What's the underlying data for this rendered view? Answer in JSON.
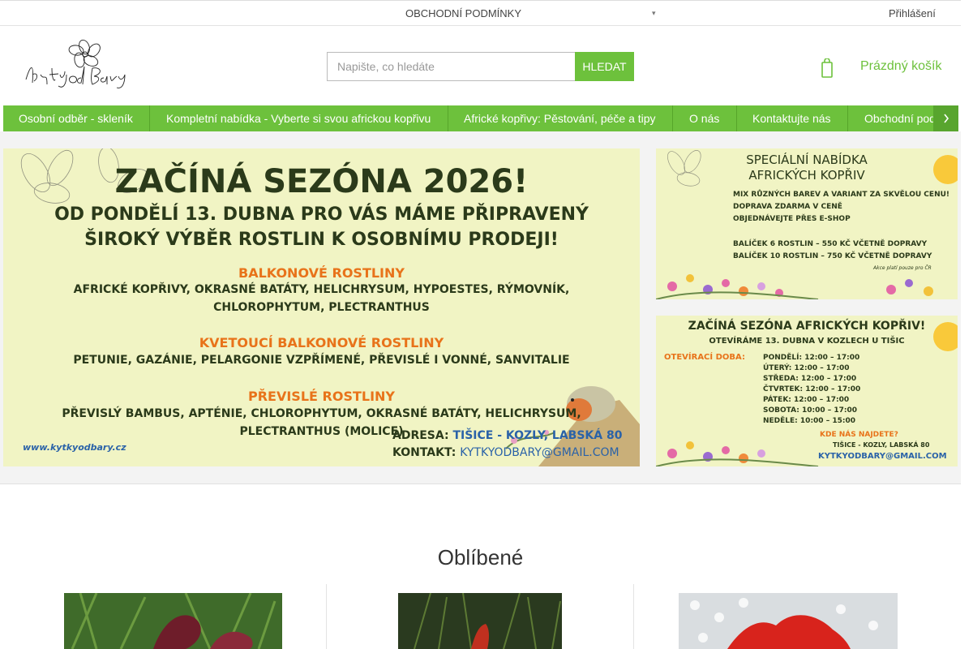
{
  "topbar": {
    "terms_label": "OBCHODNÍ PODMÍNKY",
    "icon": "chevron-icon",
    "login_label": "Přihlášení"
  },
  "header": {
    "logo_alt": "Kytky od Báry",
    "search_placeholder": "Napište, co hledáte",
    "search_button": "HLEDAT",
    "cart_label": "Prázdný košík"
  },
  "nav": {
    "items": [
      "Osobní odběr - skleník",
      "Kompletní nabídka - Vyberte si svou africkou kopřivu",
      "Africké kopřivy: Pěstování, péče a tipy",
      "O nás",
      "Kontaktujte nás",
      "Obchodní pod"
    ]
  },
  "banners": {
    "main": {
      "title": "ZAČÍNÁ SEZÓNA 2026!",
      "subtitle1": "OD PONDĚLÍ 13. DUBNA PRO VÁS MÁME PŘIPRAVENÝ",
      "subtitle2": "ŠIROKÝ VÝBĚR ROSTLIN K OSOBNÍMU PRODEJI!",
      "h1": "BALKONOVÉ ROSTLINY",
      "l1a": "AFRICKÉ KOPŘIVY, OKRASNÉ BATÁTY, HELICHRYSUM, HYPOESTES, RÝMOVNÍK,",
      "l1b": "CHLOROPHYTUM, PLECTRANTHUS",
      "h2": "KVETOUCÍ BALKONOVÉ ROSTLINY",
      "l2": "PETUNIE, GAZÁNIE, PELARGONIE VZPŘÍMENÉ, PŘEVISLÉ I VONNÉ, SANVITALIE",
      "h3": "PŘEVISLÉ ROSTLINY",
      "l3a": "PŘEVISLÝ BAMBUS, APTÉNIE, CHLOROPHYTUM, OKRASNÉ BATÁTY, HELICHRYSUM,",
      "l3b": "PLECTRANTHUS (MOLICE)",
      "address_label": "ADRESA:",
      "address": "TIŠICE - KOZLY, LABSKÁ 80",
      "contact_label": "KONTAKT:",
      "contact": "KYTKYODBARY@GMAIL.COM",
      "web": "www.kytkyodbary.cz"
    },
    "side1": {
      "title1": "SPECIÁLNÍ NABÍDKA",
      "title2": "AFRICKÝCH KOPŘIV",
      "p1": "MIX RŮZNÝCH BAREV A VARIANT ZA SKVĚLOU CENU!",
      "p2": "DOPRAVA ZDARMA V CENĚ",
      "p3": "OBJEDNÁVEJTE PŘES E-SHOP",
      "p4": "BALÍČEK 6 ROSTLIN – 550 KČ VČETNĚ DOPRAVY",
      "p5": "BALÍČEK 10 ROSTLIN – 750 KČ VČETNĚ DOPRAVY",
      "note": "Akce platí pouze pro ČR"
    },
    "side2": {
      "title": "ZAČÍNÁ SEZÓNA AFRICKÝCH KOPŘIV!",
      "sub": "OTEVÍRÁME 13. DUBNA V KOZLECH U TIŠIC",
      "hours_label": "OTEVÍRACÍ DOBA:",
      "hours": [
        "PONDĚLÍ: 12:00 – 17:00",
        "ÚTERÝ: 12:00 – 17:00",
        "STŘEDA: 12:00 – 17:00",
        "ČTVRTEK: 12:00 – 17:00",
        "PÁTEK: 12:00 – 17:00",
        "SOBOTA: 10:00 – 17:00",
        "NEDĚLE: 10:00 – 15:00"
      ],
      "find": "KDE NÁS NAJDETE?",
      "addr": "TIŠICE - KOZLY, LABSKÁ 80",
      "mail": "KYTKYODBARY@GMAIL.COM"
    }
  },
  "favorites": {
    "title": "Oblíbené"
  },
  "colors": {
    "accent": "#6dc13c",
    "accent_dark": "#58a52e",
    "banner_bg": "#f1f4c4",
    "banner_dark": "#2b3a1a",
    "banner_orange": "#e8731a",
    "banner_blue": "#2a62a8"
  }
}
